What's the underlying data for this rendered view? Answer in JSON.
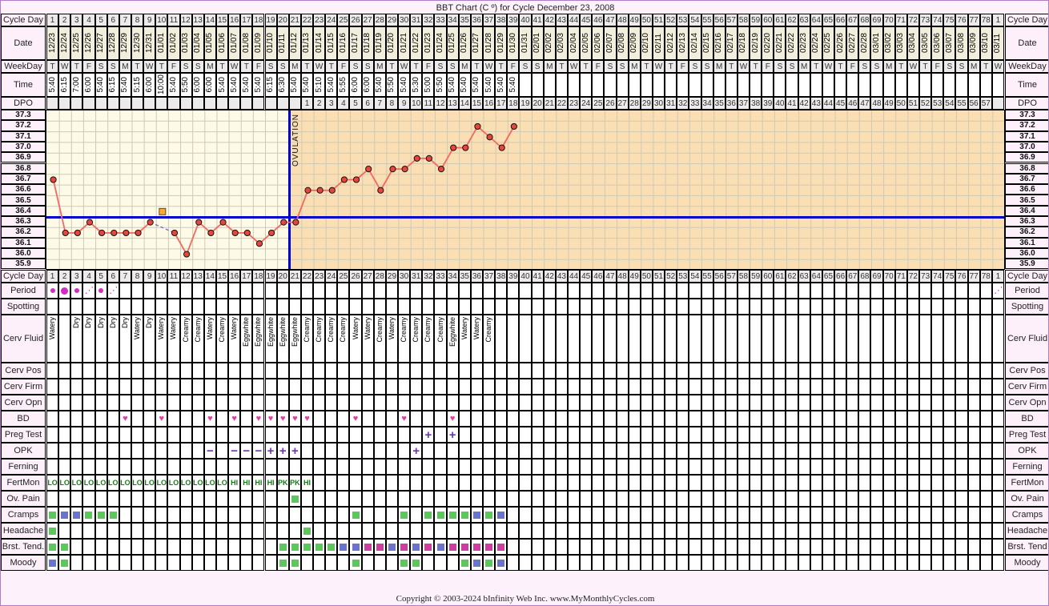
{
  "title": "BBT Chart (C º) for Cycle December 23, 2008",
  "footer": "Copyright © 2003-2024 bInfinity Web Inc.    www.MyMonthlyCycles.com",
  "row_labels": {
    "cycle_day": "Cycle Day",
    "date": "Date",
    "weekday": "WeekDay",
    "time": "Time",
    "dpo": "DPO",
    "period": "Period",
    "spotting": "Spotting",
    "cerv_fluid": "Cerv Fluid",
    "cerv_pos": "Cerv Pos",
    "cerv_firm": "Cerv Firm",
    "cerv_opn": "Cerv Opn",
    "bd": "BD",
    "preg_test": "Preg Test",
    "opk": "OPK",
    "ferning": "Ferning",
    "fertmon": "FertMon",
    "ov_pain": "Ov. Pain",
    "cramps": "Cramps",
    "headache": "Headache",
    "brst_tend": "Brst. Tend.",
    "brst_tend_right": "Brst. Tend",
    "moody": "Moody"
  },
  "ovulation_label": "OVULATION",
  "colors": {
    "temp_line": "#f4685f",
    "temp_dot_fill": "#e8463c",
    "coverline": "#0000cc",
    "luteal_bg": "#fadfb4",
    "follicular_bg": "#fdfbe8",
    "green": "#5cc85c",
    "blue": "#6a74cf",
    "magenta": "#cc3f9e",
    "heart": "#e0409b",
    "opk_purple": "#6b33c0",
    "fertmon_green": "#167a16",
    "missing_marker": "#f5a83c",
    "border": "#b07cc6"
  },
  "chart_data": {
    "type": "line",
    "title": "BBT Chart (C º) for Cycle December 23, 2008",
    "xlabel": "Cycle Day",
    "ylabel": "Temperature (C º)",
    "ylim": [
      35.85,
      37.35
    ],
    "yticks": [
      "37.3",
      "37.2",
      "37.1",
      "37.0",
      "36.9",
      "36.8",
      "36.7",
      "36.6",
      "36.5",
      "36.4",
      "36.3",
      "36.2",
      "36.1",
      "36.0",
      "35.9"
    ],
    "grid": true,
    "coverline": 36.35,
    "ovulation_day": 21,
    "total_columns": 79,
    "missing_temp_days": [
      10
    ],
    "series": [
      {
        "name": "Basal Body Temperature",
        "x": [
          1,
          2,
          3,
          4,
          5,
          6,
          7,
          8,
          9,
          11,
          12,
          13,
          14,
          15,
          16,
          17,
          18,
          19,
          20,
          21,
          22,
          23,
          24,
          25,
          26,
          27,
          28,
          29,
          30,
          31,
          32,
          33,
          34,
          35,
          36,
          37,
          38,
          39
        ],
        "values": [
          36.7,
          36.2,
          36.2,
          36.3,
          36.2,
          36.2,
          36.2,
          36.2,
          36.3,
          36.2,
          36.0,
          36.3,
          36.2,
          36.3,
          36.2,
          36.2,
          36.1,
          36.2,
          36.3,
          36.3,
          36.6,
          36.6,
          36.6,
          36.7,
          36.7,
          36.8,
          36.6,
          36.8,
          36.8,
          36.9,
          36.9,
          36.8,
          37.0,
          37.0,
          37.2,
          37.1,
          37.0,
          37.2
        ]
      }
    ],
    "cycle_days": [
      1,
      2,
      3,
      4,
      5,
      6,
      7,
      8,
      9,
      10,
      11,
      12,
      13,
      14,
      15,
      16,
      17,
      18,
      19,
      20,
      21,
      22,
      23,
      24,
      25,
      26,
      27,
      28,
      29,
      30,
      31,
      32,
      33,
      34,
      35,
      36,
      37,
      38,
      39,
      40,
      41,
      42,
      43,
      44,
      45,
      46,
      47,
      48,
      49,
      50,
      51,
      52,
      53,
      54,
      55,
      56,
      57,
      58,
      59,
      60,
      61,
      62,
      63,
      64,
      65,
      66,
      67,
      68,
      69,
      70,
      71,
      72,
      73,
      74,
      75,
      76,
      77,
      78,
      1
    ],
    "dates": [
      "12/23",
      "12/24",
      "12/25",
      "12/26",
      "12/27",
      "12/28",
      "12/29",
      "12/30",
      "12/31",
      "01/01",
      "01/02",
      "01/03",
      "01/04",
      "01/05",
      "01/06",
      "01/07",
      "01/08",
      "01/09",
      "01/10",
      "01/11",
      "01/12",
      "01/13",
      "01/14",
      "01/15",
      "01/16",
      "01/17",
      "01/18",
      "01/19",
      "01/20",
      "01/21",
      "01/22",
      "01/23",
      "01/24",
      "01/25",
      "01/26",
      "01/27",
      "01/28",
      "01/29",
      "01/30",
      "01/31",
      "02/01",
      "02/02",
      "02/03",
      "02/04",
      "02/05",
      "02/06",
      "02/07",
      "02/08",
      "02/09",
      "02/10",
      "02/11",
      "02/12",
      "02/13",
      "02/14",
      "02/15",
      "02/16",
      "02/17",
      "02/18",
      "02/19",
      "02/20",
      "02/21",
      "02/22",
      "02/23",
      "02/24",
      "02/25",
      "02/26",
      "02/27",
      "02/28",
      "03/01",
      "03/02",
      "03/03",
      "03/04",
      "03/05",
      "03/06",
      "03/07",
      "03/08",
      "03/09",
      "03/10",
      "03/11"
    ],
    "weekdays": [
      "T",
      "W",
      "T",
      "F",
      "S",
      "S",
      "M",
      "T",
      "W",
      "T",
      "F",
      "S",
      "S",
      "M",
      "T",
      "W",
      "T",
      "F",
      "S",
      "S",
      "M",
      "T",
      "W",
      "T",
      "F",
      "S",
      "S",
      "M",
      "T",
      "W",
      "T",
      "F",
      "S",
      "S",
      "M",
      "T",
      "W",
      "T",
      "F",
      "S",
      "S",
      "M",
      "T",
      "W",
      "T",
      "F",
      "S",
      "S",
      "M",
      "T",
      "W",
      "T",
      "F",
      "S",
      "S",
      "M",
      "T",
      "W",
      "T",
      "F",
      "S",
      "S",
      "M",
      "T",
      "W",
      "T",
      "F",
      "S",
      "S",
      "M",
      "T",
      "W",
      "T",
      "F",
      "S",
      "S",
      "M",
      "T",
      "W"
    ],
    "times": [
      "5:40",
      "6:15",
      "7:00",
      "6:00",
      "5:40",
      "6:15",
      "5:40",
      "5:15",
      "6:00",
      "10:00",
      "5:40",
      "5:50",
      "6:00",
      "6:00",
      "5:40",
      "5:40",
      "5:40",
      "5:40",
      "6:15",
      "6:30",
      "5:40",
      "5:40",
      "5:10",
      "5:40",
      "5:55",
      "6:00",
      "6:00",
      "5:40",
      "5:50",
      "5:40",
      "5:30",
      "5:00",
      "5:50",
      "5:40",
      "5:40",
      "5:40",
      "5:40",
      "5:40",
      "5:40",
      "",
      "",
      "",
      "",
      "",
      "",
      "",
      "",
      "",
      "",
      "",
      "",
      "",
      "",
      "",
      "",
      "",
      "",
      "",
      "",
      "",
      "",
      "",
      "",
      "",
      "",
      "",
      "",
      "",
      "",
      "",
      "",
      "",
      "",
      "",
      "",
      "",
      "",
      "",
      ""
    ],
    "dpo": [
      "",
      "",
      "",
      "",
      "",
      "",
      "",
      "",
      "",
      "",
      "",
      "",
      "",
      "",
      "",
      "",
      "",
      "",
      "",
      "",
      "",
      "1",
      "2",
      "3",
      "4",
      "5",
      "6",
      "7",
      "8",
      "9",
      "10",
      "11",
      "12",
      "13",
      "14",
      "15",
      "16",
      "17",
      "18",
      "19",
      "20",
      "21",
      "22",
      "23",
      "24",
      "25",
      "26",
      "27",
      "28",
      "29",
      "30",
      "31",
      "32",
      "33",
      "34",
      "35",
      "36",
      "37",
      "38",
      "39",
      "40",
      "41",
      "42",
      "43",
      "44",
      "45",
      "46",
      "47",
      "48",
      "49",
      "50",
      "51",
      "52",
      "53",
      "54",
      "55",
      "56",
      "57",
      ""
    ],
    "period": [
      {
        "day": 1,
        "level": "light"
      },
      {
        "day": 2,
        "level": "heavy"
      },
      {
        "day": 3,
        "level": "light"
      },
      {
        "day": 4,
        "level": "spot"
      },
      {
        "day": 5,
        "level": "light"
      },
      {
        "day": 6,
        "level": "spot"
      },
      {
        "day": 79,
        "level": "spot"
      }
    ],
    "cerv_fluid": {
      "1": "Watery",
      "3": "Dry",
      "4": "Dry",
      "5": "Dry",
      "6": "Dry",
      "7": "Dry",
      "8": "Watery",
      "9": "Dry",
      "10": "Watery",
      "11": "Watery",
      "12": "Creamy",
      "13": "Creamy",
      "14": "Watery",
      "15": "Creamy",
      "16": "Watery",
      "17": "Eggwhite",
      "18": "Eggwhite",
      "19": "Eggwhite",
      "20": "Eggwhite",
      "21": "Eggwhite",
      "22": "Creamy",
      "23": "Creamy",
      "24": "Creamy",
      "25": "Creamy",
      "26": "Watery",
      "27": "Watery",
      "28": "Creamy",
      "29": "Watery",
      "30": "Creamy",
      "31": "Creamy",
      "32": "Creamy",
      "33": "Creamy",
      "34": "Eggwhite",
      "35": "Watery",
      "36": "Watery",
      "37": "Creamy"
    },
    "bd_days": [
      7,
      10,
      14,
      16,
      18,
      19,
      20,
      21,
      22,
      26,
      30,
      34
    ],
    "preg_test_days": [
      32,
      34
    ],
    "opk": {
      "negative": [
        14,
        16,
        17,
        18
      ],
      "positive": [
        19,
        20,
        21,
        31
      ]
    },
    "fertmon": [
      "LO",
      "LO",
      "LO",
      "LO",
      "LO",
      "LO",
      "LO",
      "LO",
      "LO",
      "LO",
      "LO",
      "LO",
      "LO",
      "LO",
      "LO",
      "HI",
      "HI",
      "HI",
      "HI",
      "PK",
      "PK",
      "HI"
    ],
    "ov_pain_days": [
      {
        "day": 21,
        "color": "green"
      }
    ],
    "cramps": [
      {
        "day": 1,
        "color": "green"
      },
      {
        "day": 2,
        "color": "blue"
      },
      {
        "day": 3,
        "color": "blue"
      },
      {
        "day": 4,
        "color": "green"
      },
      {
        "day": 5,
        "color": "green"
      },
      {
        "day": 6,
        "color": "green"
      },
      {
        "day": 26,
        "color": "green"
      },
      {
        "day": 30,
        "color": "green"
      },
      {
        "day": 32,
        "color": "green"
      },
      {
        "day": 33,
        "color": "green"
      },
      {
        "day": 34,
        "color": "green"
      },
      {
        "day": 35,
        "color": "green"
      },
      {
        "day": 36,
        "color": "blue"
      },
      {
        "day": 37,
        "color": "green"
      },
      {
        "day": 38,
        "color": "blue"
      }
    ],
    "headache": [
      {
        "day": 1,
        "color": "green"
      },
      {
        "day": 22,
        "color": "green"
      }
    ],
    "brst_tend": [
      {
        "day": 1,
        "color": "green"
      },
      {
        "day": 2,
        "color": "green"
      },
      {
        "day": 20,
        "color": "green"
      },
      {
        "day": 21,
        "color": "green"
      },
      {
        "day": 22,
        "color": "green"
      },
      {
        "day": 23,
        "color": "green"
      },
      {
        "day": 24,
        "color": "green"
      },
      {
        "day": 25,
        "color": "blue"
      },
      {
        "day": 26,
        "color": "blue"
      },
      {
        "day": 27,
        "color": "magenta"
      },
      {
        "day": 28,
        "color": "magenta"
      },
      {
        "day": 29,
        "color": "blue"
      },
      {
        "day": 30,
        "color": "magenta"
      },
      {
        "day": 31,
        "color": "blue"
      },
      {
        "day": 32,
        "color": "magenta"
      },
      {
        "day": 33,
        "color": "blue"
      },
      {
        "day": 34,
        "color": "magenta"
      },
      {
        "day": 35,
        "color": "magenta"
      },
      {
        "day": 36,
        "color": "magenta"
      },
      {
        "day": 37,
        "color": "magenta"
      },
      {
        "day": 38,
        "color": "magenta"
      }
    ],
    "moody": [
      {
        "day": 1,
        "color": "blue"
      },
      {
        "day": 2,
        "color": "green"
      },
      {
        "day": 20,
        "color": "green"
      },
      {
        "day": 21,
        "color": "green"
      },
      {
        "day": 26,
        "color": "green"
      },
      {
        "day": 30,
        "color": "green"
      },
      {
        "day": 31,
        "color": "green"
      },
      {
        "day": 35,
        "color": "green"
      },
      {
        "day": 36,
        "color": "blue"
      },
      {
        "day": 37,
        "color": "green"
      },
      {
        "day": 38,
        "color": "blue"
      }
    ]
  }
}
